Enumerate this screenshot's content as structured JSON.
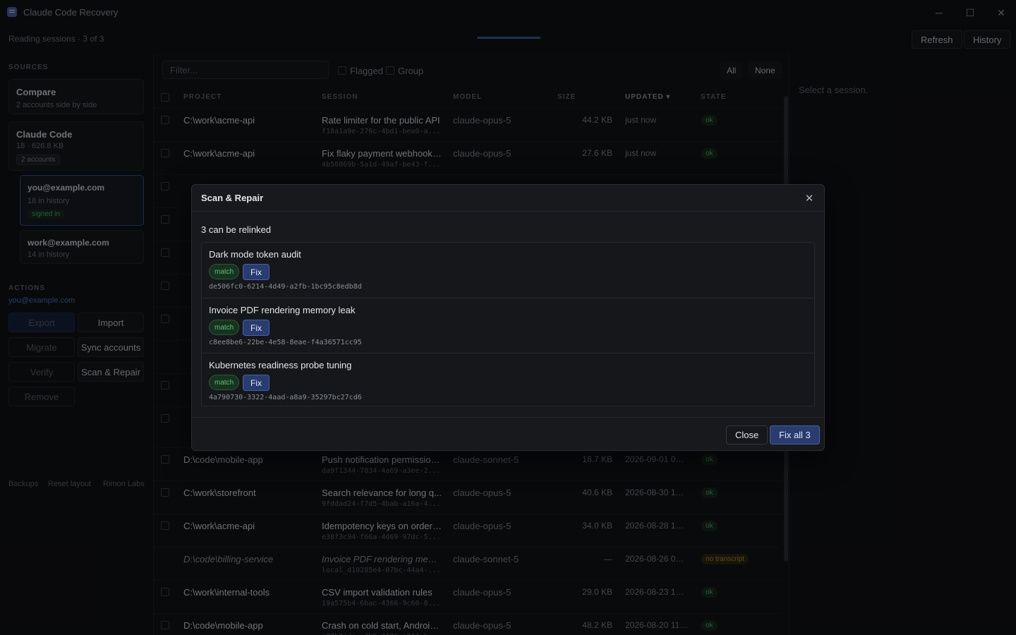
{
  "window": {
    "title": "Claude Code Recovery",
    "minimize": "─",
    "maximize": "☐",
    "close": "✕"
  },
  "status": {
    "text": "Reading sessions · 3 of 3",
    "progress": 1.0
  },
  "top_buttons": {
    "refresh": "Refresh",
    "history": "History"
  },
  "sidebar": {
    "sources_label": "SOURCES",
    "compare": {
      "title": "Compare",
      "subtitle": "2 accounts side by side"
    },
    "claude_code": {
      "title": "Claude Code",
      "subtitle": "18 · 626.8 KB",
      "badge": "2 accounts"
    },
    "accounts": [
      {
        "email": "you@example.com",
        "history": "18 in history",
        "badge": "signed in"
      },
      {
        "email": "work@example.com",
        "history": "14 in history"
      }
    ],
    "actions_label": "ACTIONS",
    "actions_account": "you@example.com",
    "actions": {
      "export": "Export",
      "import": "Import",
      "migrate": "Migrate",
      "sync": "Sync accounts",
      "verify": "Verify",
      "scan": "Scan & Repair",
      "remove": "Remove"
    },
    "links": {
      "backups": "Backups",
      "reset": "Reset layout",
      "brand": "Rimon Labs"
    }
  },
  "table": {
    "filter_placeholder": "Filter...",
    "flagged_label": "Flagged",
    "group_label": "Group",
    "all_label": "All",
    "none_label": "None",
    "headers": {
      "project": "PROJECT",
      "session": "SESSION",
      "model": "MODEL",
      "size": "SIZE",
      "updated": "UPDATED ▾",
      "state": "STATE"
    },
    "rows": [
      {
        "project": "C:\\work\\acme-api",
        "session": "Rate limiter for the public API",
        "id": "f18a1a9e-276c-4bd1-bea0-a...",
        "model": "claude-opus-5",
        "size": "44.2 KB",
        "updated": "just now",
        "state": "ok"
      },
      {
        "project": "C:\\work\\acme-api",
        "session": "Fix flaky payment webhook ...",
        "id": "4b56069b-5a1d-49af-be43-f...",
        "model": "claude-opus-5",
        "size": "27.6 KB",
        "updated": "just now",
        "state": "ok"
      },
      {
        "project": "D:\\code\\mobile-app",
        "session": "Push notification permission...",
        "id": "da9f1344-7834-4a69-a3ee-2...",
        "model": "claude-sonnet-5",
        "size": "18.7 KB",
        "updated": "2026-09-01 08:...",
        "state": "ok"
      },
      {
        "project": "C:\\work\\storefront",
        "session": "Search relevance for long q...",
        "id": "9fddad24-f7d5-4bab-a16a-4...",
        "model": "claude-opus-5",
        "size": "40.6 KB",
        "updated": "2026-08-30 13:...",
        "state": "ok"
      },
      {
        "project": "C:\\work\\acme-api",
        "session": "Idempotency keys on order ...",
        "id": "e38f3c94-f66a-4d69-97dc-5...",
        "model": "claude-opus-5",
        "size": "34.0 KB",
        "updated": "2026-08-28 15:...",
        "state": "ok"
      },
      {
        "project": "D:\\code\\billing-service",
        "session": "Invoice PDF rendering memo...",
        "id": "local_d10285e4-07bc-44a4-...",
        "model": "claude-sonnet-5",
        "size": "—",
        "updated": "2026-08-26 05:...",
        "state": "no transcript"
      },
      {
        "project": "C:\\work\\internal-tools",
        "session": "CSV import validation rules",
        "id": "19a575b4-6bac-4366-9c60-8...",
        "model": "claude-opus-5",
        "size": "29.0 KB",
        "updated": "2026-08-23 15:...",
        "state": "ok"
      },
      {
        "project": "D:\\code\\mobile-app",
        "session": "Crash on cold start, Android...",
        "id": "e77b2cde-e4b5-4f36-a914-b...",
        "model": "claude-opus-5",
        "size": "48.2 KB",
        "updated": "2026-08-20 11:...",
        "state": "ok"
      }
    ]
  },
  "detail": {
    "placeholder": "Select a session."
  },
  "modal": {
    "title": "Scan & Repair",
    "summary": "3 can be relinked",
    "items": [
      {
        "name": "Dark mode token audit",
        "badge": "match",
        "fix": "Fix",
        "uuid": "de506fc0-6214-4d49-a2fb-1bc95c8edb8d"
      },
      {
        "name": "Invoice PDF rendering memory leak",
        "badge": "match",
        "fix": "Fix",
        "uuid": "c8ee8be6-22be-4e58-8eae-f4a36571cc95"
      },
      {
        "name": "Kubernetes readiness probe tuning",
        "badge": "match",
        "fix": "Fix",
        "uuid": "4a790730-3322-4aad-a8a9-35297bc27cd6"
      }
    ],
    "close": "Close",
    "fix_all": "Fix all 3"
  }
}
